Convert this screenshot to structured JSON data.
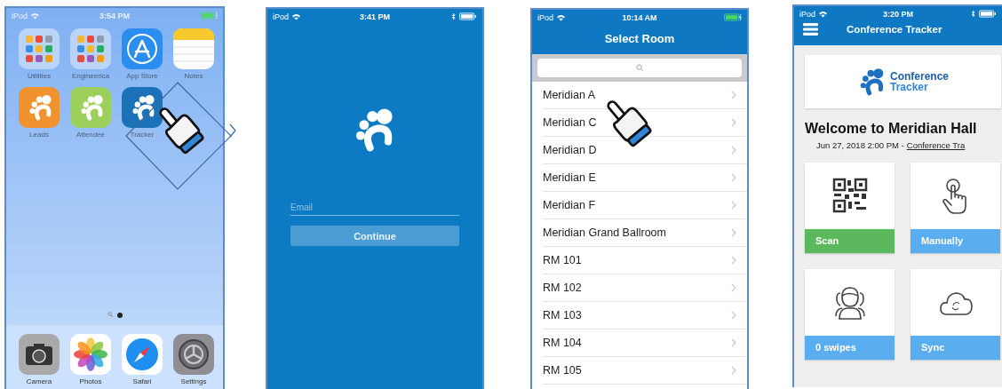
{
  "screens": [
    {
      "kind": "home",
      "status_bar": {
        "carrier": "iPod",
        "time": "3:54 PM",
        "bluetooth": false,
        "charging": true
      },
      "apps": [
        {
          "label": "Utilities",
          "kind": "folder"
        },
        {
          "label": "Engineerica",
          "kind": "folder"
        },
        {
          "label": "App Store",
          "kind": "app_store"
        },
        {
          "label": "Notes",
          "kind": "notes"
        },
        {
          "label": "Leads",
          "kind": "paw",
          "color": "#f0922e"
        },
        {
          "label": "Attendee",
          "kind": "paw",
          "color": "#9ccf5c"
        },
        {
          "label": "Tracker",
          "kind": "paw",
          "color": "#1c72b8"
        }
      ],
      "dock": [
        {
          "label": "Camera",
          "kind": "camera"
        },
        {
          "label": "Photos",
          "kind": "photos"
        },
        {
          "label": "Safari",
          "kind": "safari"
        },
        {
          "label": "Settings",
          "kind": "settings"
        }
      ]
    },
    {
      "kind": "login",
      "status_bar": {
        "carrier": "iPod",
        "time": "3:41 PM",
        "bluetooth": true,
        "charging": false
      },
      "email": {
        "placeholder": "Email"
      },
      "button": "Continue"
    },
    {
      "kind": "room_list",
      "status_bar": {
        "carrier": "iPod",
        "time": "10:14 AM",
        "bluetooth": false,
        "charging": true
      },
      "title": "Select Room",
      "rooms": [
        "Meridian A",
        "Meridian C",
        "Meridian D",
        "Meridian E",
        "Meridian F",
        "Meridian Grand Ballroom",
        "RM 101",
        "RM 102",
        "RM 103",
        "RM 104",
        "RM 105"
      ]
    },
    {
      "kind": "dashboard",
      "status_bar": {
        "carrier": "iPod",
        "time": "3:20 PM",
        "bluetooth": true,
        "charging": false
      },
      "title": "Conference Tracker",
      "logo_text": [
        "Conference",
        "Tracker"
      ],
      "heading": "Welcome to Meridian Hall",
      "date": "Jun 27, 2018 2:00 PM -",
      "link": "Conference Tra",
      "tiles": [
        {
          "label": "Scan",
          "kind": "qr",
          "color": "#5cb85c"
        },
        {
          "label": "Manually",
          "kind": "tap",
          "color": "#5aaef0"
        },
        {
          "label": "0 swipes",
          "kind": "people",
          "color": "#5aaef0"
        },
        {
          "label": "Sync",
          "kind": "cloud",
          "color": "#5aaef0"
        }
      ]
    }
  ]
}
